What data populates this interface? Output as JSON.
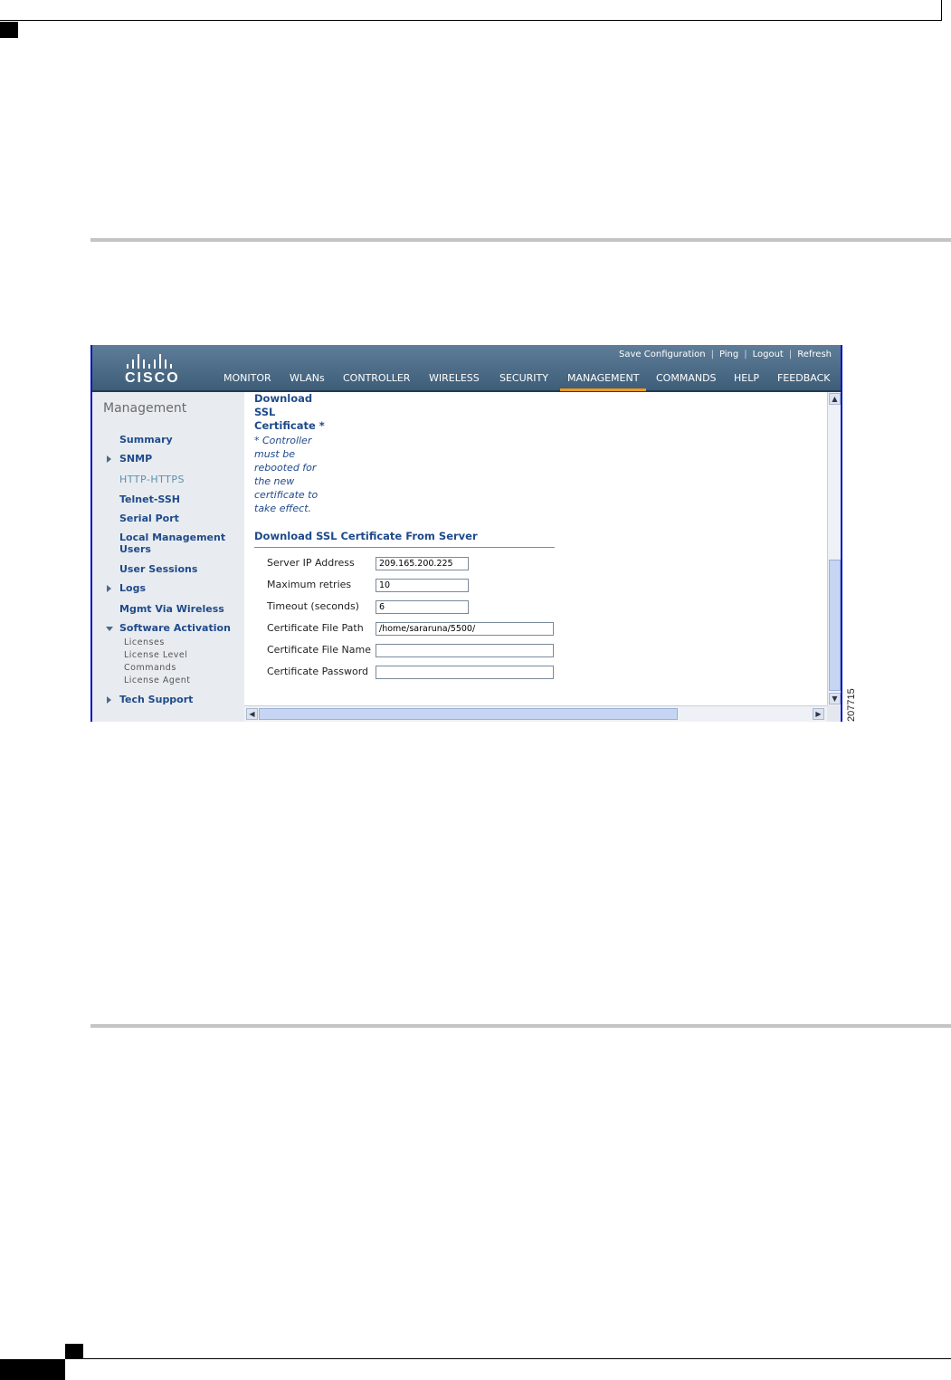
{
  "figure": {
    "id": "207715"
  },
  "header": {
    "utility_links": [
      "Save Configuration",
      "Ping",
      "Logout",
      "Refresh"
    ],
    "logo_text": "CISCO",
    "nav": [
      "MONITOR",
      "WLANs",
      "CONTROLLER",
      "WIRELESS",
      "SECURITY",
      "MANAGEMENT",
      "COMMANDS",
      "HELP",
      "FEEDBACK"
    ],
    "active_nav": "MANAGEMENT"
  },
  "sidebar": {
    "title": "Management",
    "items": [
      "Summary",
      "SNMP",
      "HTTP-HTTPS",
      "Telnet-SSH",
      "Serial Port",
      "Local Management Users",
      "User Sessions",
      "Logs",
      "Mgmt Via Wireless",
      "Software Activation",
      "Tech Support"
    ],
    "sub_items": [
      "Licenses",
      "License Level",
      "Commands",
      "License Agent"
    ],
    "current": "HTTP-HTTPS"
  },
  "content": {
    "heading": "Download SSL Certificate *",
    "note": "* Controller must be rebooted for the new certificate to take effect.",
    "section_title": "Download SSL Certificate From Server",
    "fields": [
      {
        "label": "Server IP Address",
        "value": "209.165.200.225"
      },
      {
        "label": "Maximum retries",
        "value": "10"
      },
      {
        "label": "Timeout (seconds)",
        "value": "6"
      },
      {
        "label": "Certificate File Path",
        "value": "/home/sararuna/5500/"
      },
      {
        "label": "Certificate File Name",
        "value": ""
      },
      {
        "label": "Certificate Password",
        "value": ""
      }
    ]
  },
  "colors": {
    "banner": "#4d6c88",
    "active_tab": "#f39a1e",
    "link": "#1f4a8a"
  }
}
